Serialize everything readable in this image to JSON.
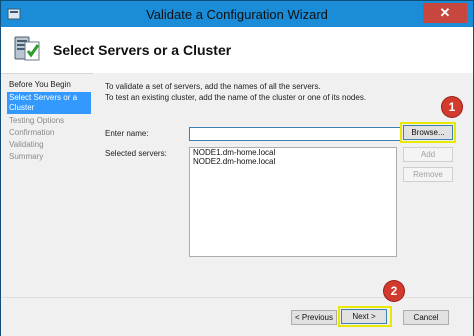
{
  "window": {
    "title": "Validate a Configuration Wizard",
    "close_symbol": "✕"
  },
  "header": {
    "title": "Select Servers or a Cluster"
  },
  "nav": {
    "items": [
      {
        "label": "Before You Begin"
      },
      {
        "label": "Select Servers or a Cluster"
      },
      {
        "label": "Testing Options"
      },
      {
        "label": "Confirmation"
      },
      {
        "label": "Validating"
      },
      {
        "label": "Summary"
      }
    ]
  },
  "content": {
    "instructions": [
      "To validate a set of servers, add the names of all the servers.",
      "To test an existing cluster, add the name of the cluster or one of its nodes."
    ],
    "enter_name_label": "Enter name:",
    "enter_name_value": "",
    "selected_servers_label": "Selected servers:",
    "selected_servers": [
      "NODE1.dm-home.local",
      "NODE2.dm-home.local"
    ],
    "browse_label": "Browse...",
    "add_label": "Add",
    "remove_label": "Remove"
  },
  "footer": {
    "previous_label": "< Previous",
    "next_label": "Next >",
    "cancel_label": "Cancel"
  },
  "annotations": {
    "badge1": "1",
    "badge2": "2"
  },
  "colors": {
    "titlebar": "#1a8cd8",
    "selected_nav": "#3399ff",
    "highlight": "#e8e800",
    "badge": "#d23a2e"
  }
}
